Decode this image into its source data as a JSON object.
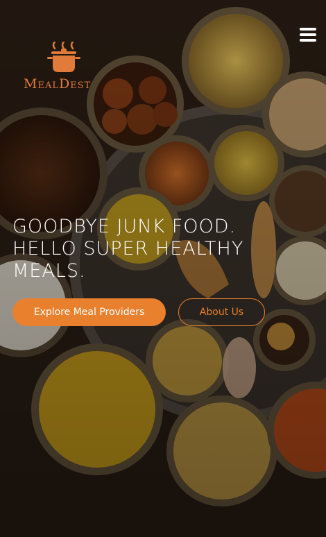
{
  "brand": {
    "name": "MealDest",
    "accent": "#e9802d"
  },
  "hero": {
    "headline_lines": [
      "GOODBYE JUNK FOOD.",
      "HELLO SUPER HEALTHY",
      "MEALS."
    ]
  },
  "buttons": {
    "primary_label": "Explore Meal Providers",
    "secondary_label": "About Us"
  },
  "nav": {
    "menu_icon": "hamburger-menu-icon"
  }
}
